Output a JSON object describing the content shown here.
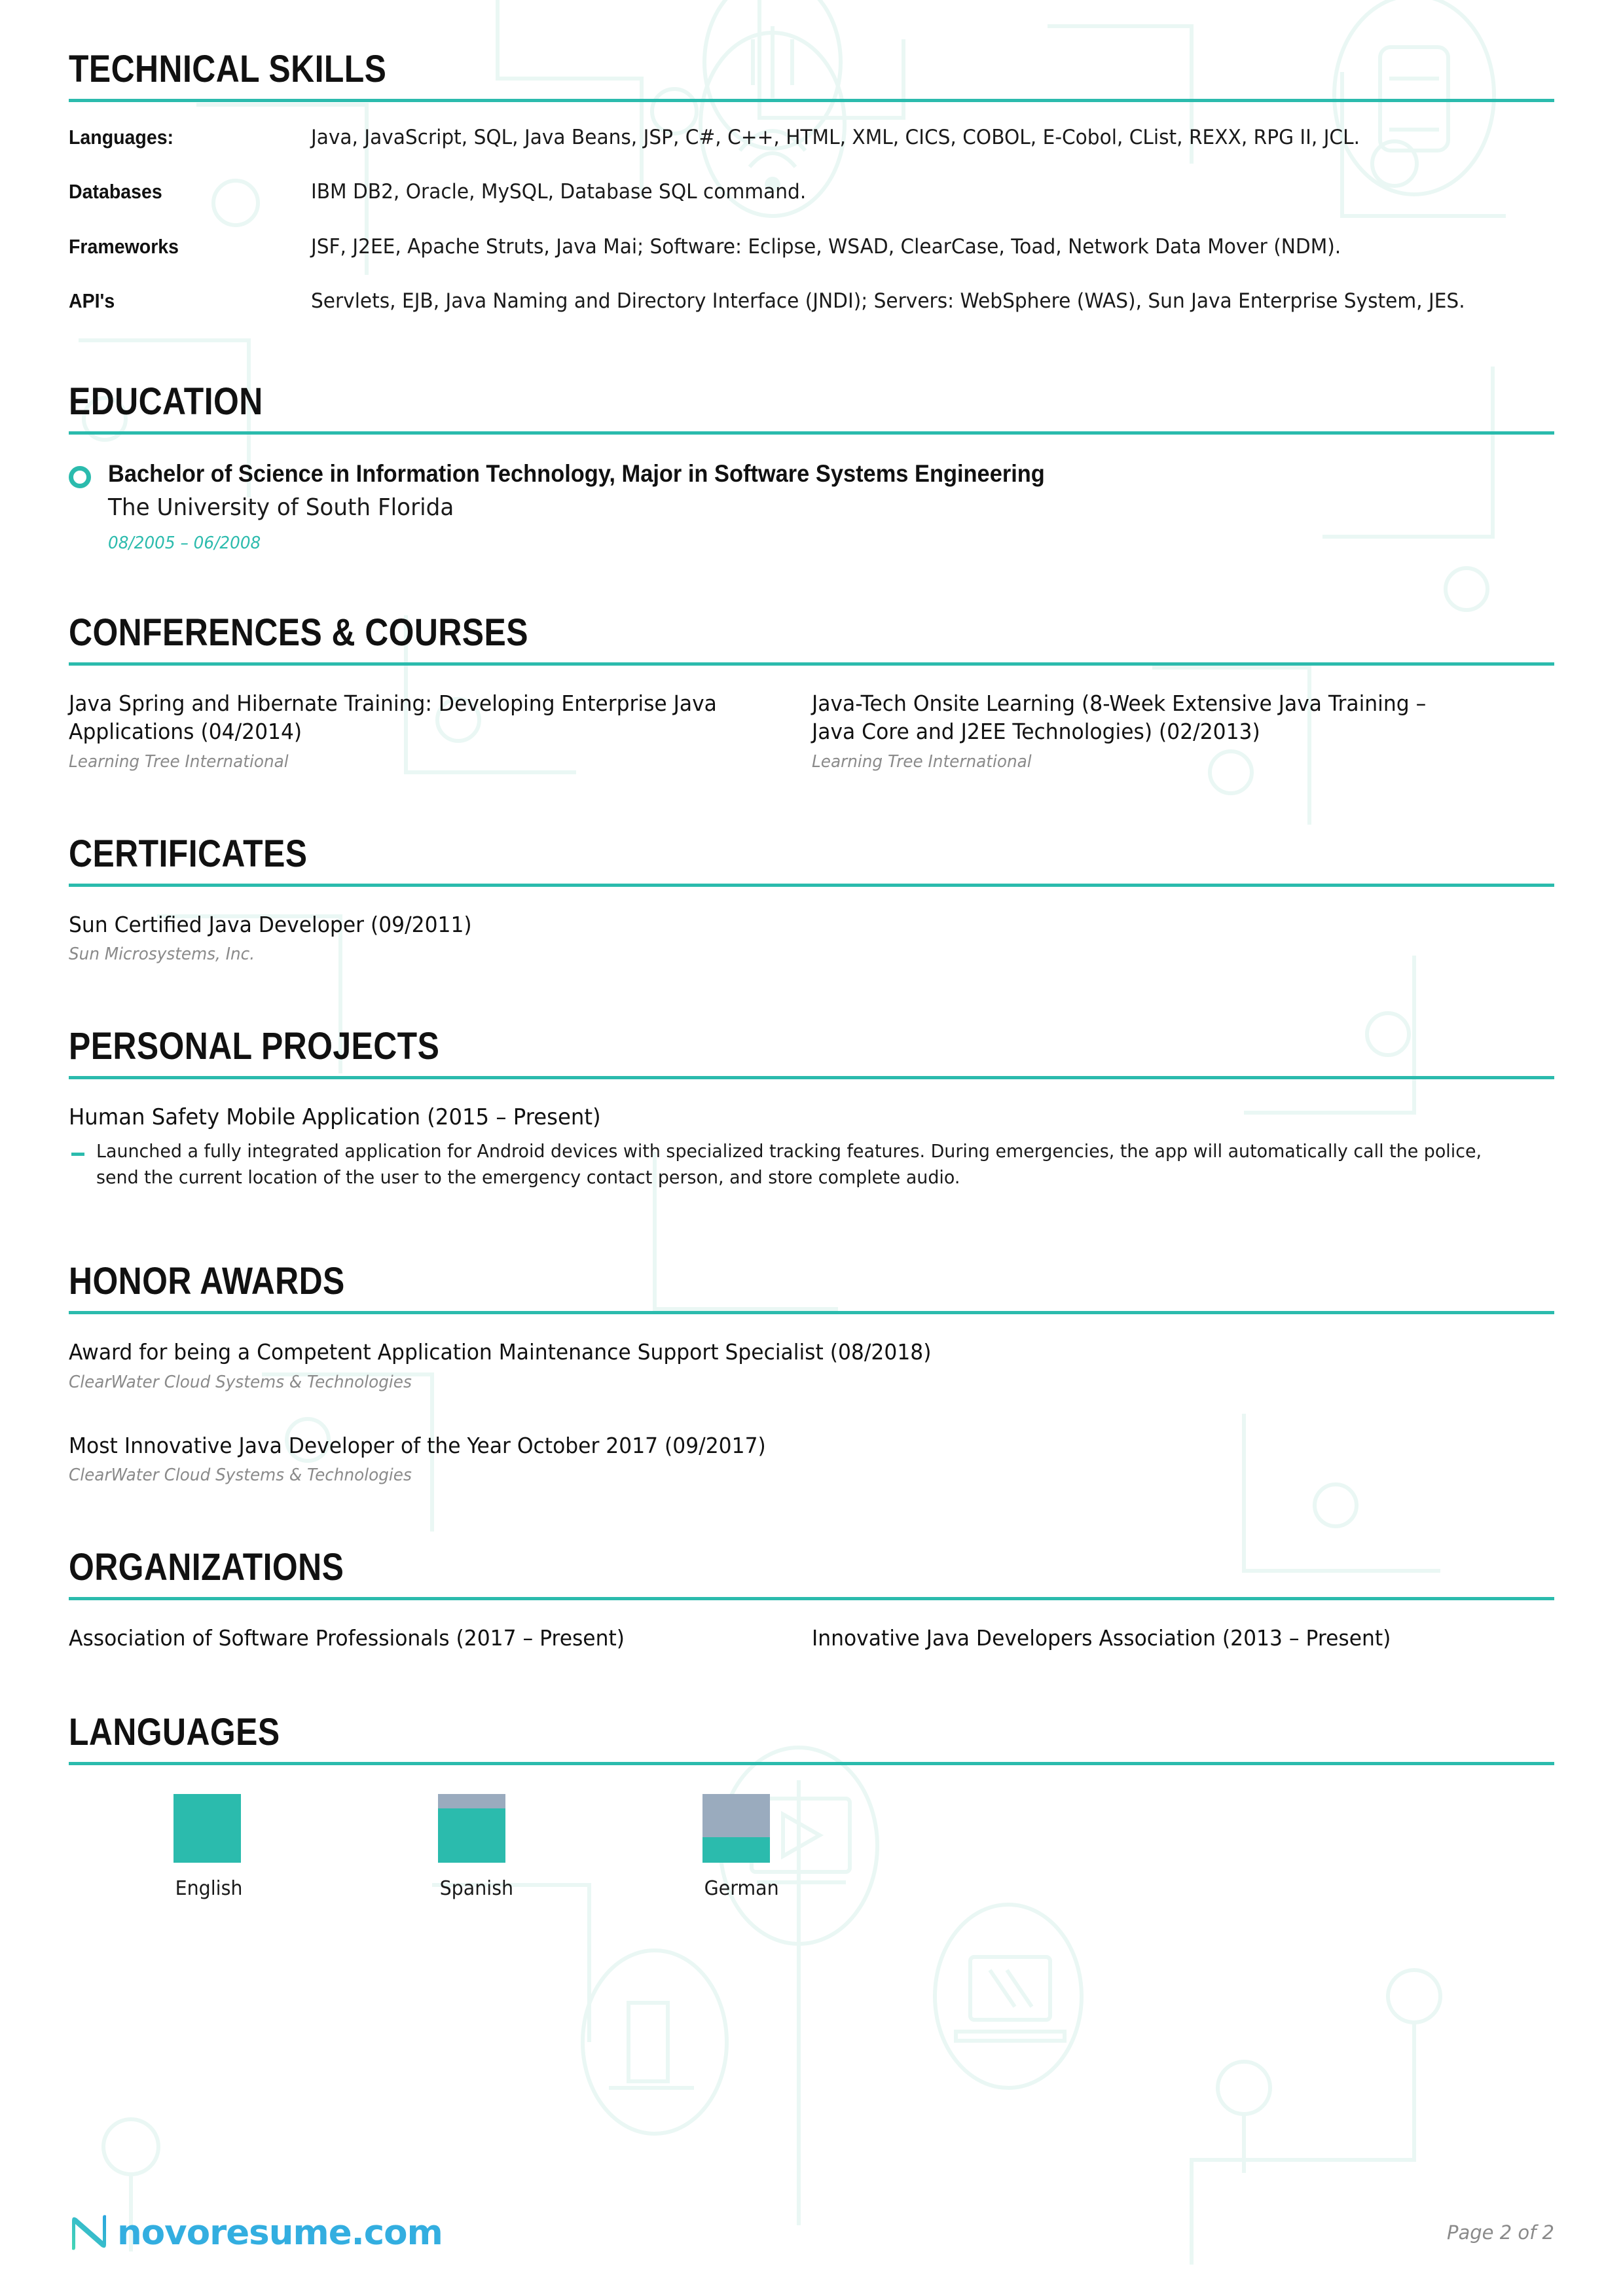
{
  "accent_color": "#2BBBAD",
  "gray_bar_color": "#9AABBE",
  "sections": {
    "technical_skills": {
      "heading": "TECHNICAL SKILLS",
      "rows": [
        {
          "label": "Languages:",
          "value": "Java, JavaScript, SQL, Java Beans, JSP, C#, C++, HTML, XML, CICS, COBOL, E-Cobol, CList, REXX, RPG II, JCL."
        },
        {
          "label": "Databases",
          "value": "IBM DB2, Oracle, MySQL, Database SQL command."
        },
        {
          "label": "Frameworks",
          "value": "JSF, J2EE, Apache Struts, Java Mai; Software: Eclipse, WSAD, ClearCase, Toad, Network Data Mover (NDM)."
        },
        {
          "label": "API's",
          "value": "Servlets, EJB, Java Naming and Directory Interface (JNDI); Servers: WebSphere (WAS), Sun Java Enterprise System, JES."
        }
      ]
    },
    "education": {
      "heading": "EDUCATION",
      "degree": "Bachelor of Science in Information Technology, Major in Software Systems Engineering",
      "school": "The University of South Florida",
      "dates": "08/2005 – 06/2008"
    },
    "conferences": {
      "heading": "CONFERENCES & COURSES",
      "items": [
        {
          "title": "Java Spring and Hibernate Training: Developing Enterprise Java Applications (04/2014)",
          "sub": "Learning Tree International"
        },
        {
          "title": "Java-Tech Onsite Learning (8-Week Extensive Java Training – Java Core and J2EE Technologies) (02/2013)",
          "sub": "Learning Tree International"
        }
      ]
    },
    "certificates": {
      "heading": "CERTIFICATES",
      "items": [
        {
          "title": "Sun Certified Java Developer (09/2011)",
          "sub": "Sun Microsystems, Inc."
        }
      ]
    },
    "personal_projects": {
      "heading": "PERSONAL PROJECTS",
      "title": "Human Safety Mobile Application (2015 – Present)",
      "bullet": "Launched a fully integrated application for Android devices with specialized tracking features. During emergencies, the app will automatically call the police, send the current location of the user to the emergency contact person, and store complete audio."
    },
    "honor_awards": {
      "heading": "HONOR AWARDS",
      "items": [
        {
          "title": "Award for being a Competent Application Maintenance Support Specialist (08/2018)",
          "sub": "ClearWater Cloud Systems & Technologies"
        },
        {
          "title": "Most Innovative Java Developer of the Year October 2017 (09/2017)",
          "sub": "ClearWater Cloud Systems & Technologies"
        }
      ]
    },
    "organizations": {
      "heading": "ORGANIZATIONS",
      "items": [
        {
          "title": "Association of Software Professionals (2017 – Present)"
        },
        {
          "title": "Innovative Java Developers Association (2013 – Present)"
        }
      ]
    },
    "languages": {
      "heading": "LANGUAGES",
      "items": [
        {
          "name": "English",
          "level_percent": 100
        },
        {
          "name": "Spanish",
          "level_percent": 79
        },
        {
          "name": "German",
          "level_percent": 37
        }
      ]
    }
  },
  "footer": {
    "logo_text": "novoresume.com",
    "page_label": "Page 2 of 2"
  }
}
